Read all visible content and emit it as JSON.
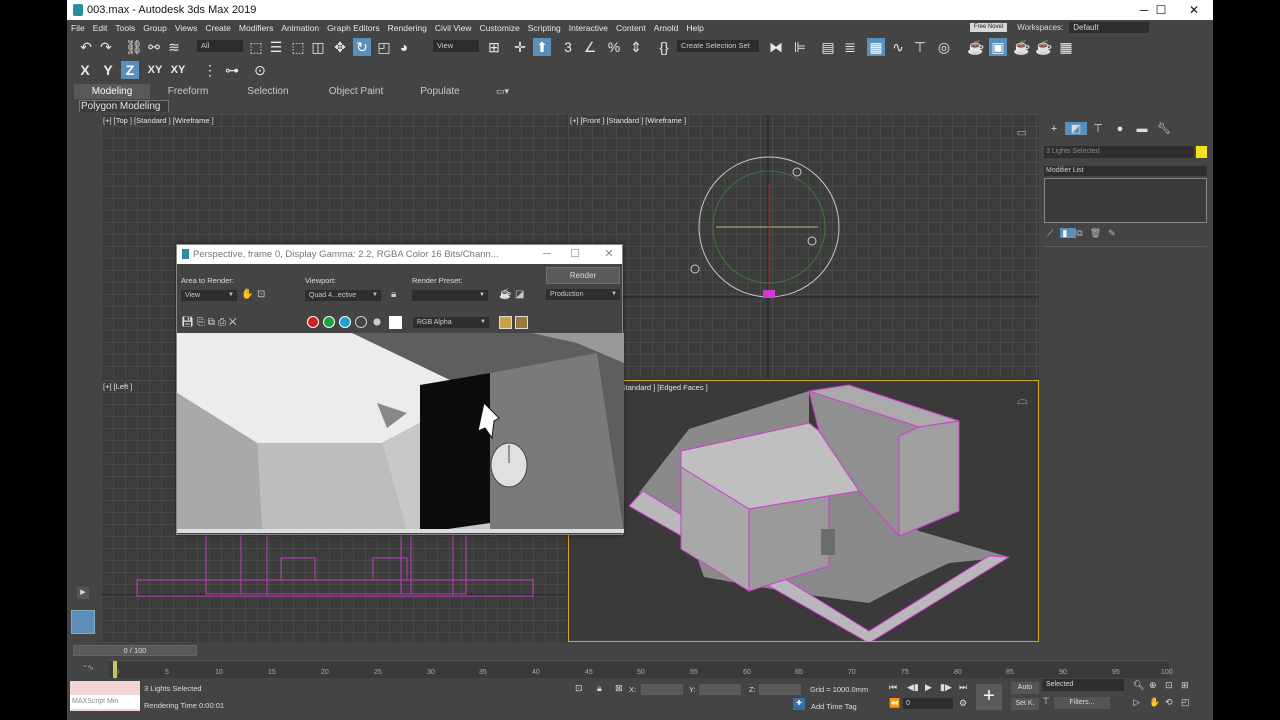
{
  "window": {
    "title": "003.max - Autodesk 3ds Max 2019",
    "minimize": "─",
    "maximize": "☐",
    "close": "✕"
  },
  "menu": {
    "items": [
      "File",
      "Edit",
      "Tools",
      "Group",
      "Views",
      "Create",
      "Modifiers",
      "Animation",
      "Graph Editors",
      "Rendering",
      "Civil View",
      "Customize",
      "Scripting",
      "Interactive",
      "Content",
      "Arnold",
      "Help"
    ],
    "user": "Free Novel",
    "workspaces_label": "Workspaces:",
    "workspaces_value": "Default"
  },
  "toolbar": {
    "selection_filter": "All",
    "ref_coord": "View",
    "named_selection": "Create Selection Set",
    "axis_x": "X",
    "axis_y": "Y",
    "axis_z": "Z",
    "axis_xy": "XY",
    "axis_xy2": "XY"
  },
  "ribbon": {
    "tabs": [
      "Modeling",
      "Freeform",
      "Selection",
      "Object Paint",
      "Populate"
    ],
    "active": "Modeling",
    "panel_tab": "Polygon Modeling"
  },
  "viewports": {
    "top": "[+] [Top ] [Standard ] [Wireframe ]",
    "front": "[+] [Front ] [Standard ] [Wireframe ]",
    "left": "[+] [Left ]",
    "perspective": "[Perspective ] [Standard ] [Edged Faces ]"
  },
  "render_window": {
    "title": "Perspective, frame 0, Display Gamma: 2.2, RGBA Color 16 Bits/Chann...",
    "area_label": "Area to Render:",
    "area_value": "View",
    "viewport_label": "Viewport:",
    "viewport_value": "Quad 4...ective",
    "preset_label": "Render Preset:",
    "preset_value": "",
    "render_button": "Render",
    "production": "Production",
    "channel_display": "RGB Alpha"
  },
  "command_panel": {
    "selection_name": "3 Lights Selected",
    "modifier_list": "Modifier List",
    "swatch_color": "#f4e21a"
  },
  "timeline": {
    "slider": "0 / 100",
    "ticks": [
      "0",
      "5",
      "10",
      "15",
      "20",
      "25",
      "30",
      "35",
      "40",
      "45",
      "50",
      "55",
      "60",
      "65",
      "70",
      "75",
      "80",
      "85",
      "90",
      "95",
      "100"
    ]
  },
  "status": {
    "maxscript": "MAXScript Min",
    "selected": "3 Lights Selected",
    "rendering_time": "Rendering Time  0:00:01",
    "x_label": "X:",
    "y_label": "Y:",
    "z_label": "Z:",
    "grid": "Grid = 1000.0mm",
    "add_time_tag": "Add Time Tag",
    "frame": "0",
    "auto": "Auto",
    "setk": "Set K.",
    "selected_dropdown": "Selected",
    "filters": "Filters..."
  }
}
